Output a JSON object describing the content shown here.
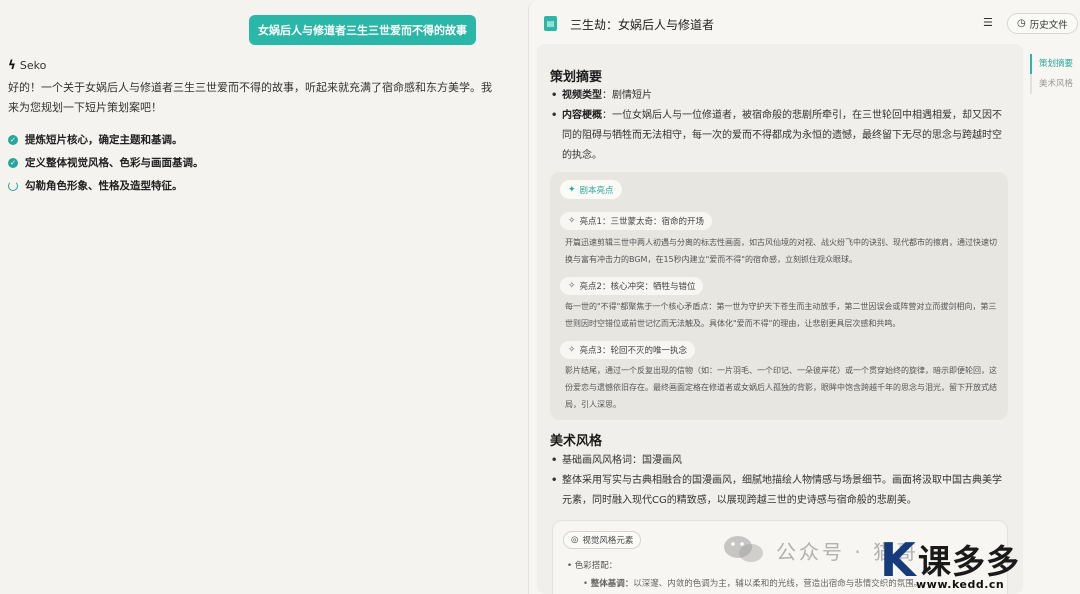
{
  "chat": {
    "user_message": "女娲后人与修道者三生三世爱而不得的故事",
    "assistant_name": "Seko",
    "assistant_intro": "好的！一个关于女娲后人与修道者三生三世爱而不得的故事，听起来就充满了宿命感和东方美学。我来为您规划一下短片策划案吧！",
    "steps": [
      {
        "label": "提炼短片核心，确定主题和基调。",
        "status": "done"
      },
      {
        "label": "定义整体视觉风格、色彩与画面基调。",
        "status": "done"
      },
      {
        "label": "勾勒角色形象、性格及造型特征。",
        "status": "in-progress"
      }
    ]
  },
  "doc": {
    "title": "三生劫：女娲后人与修道者",
    "history_label": "历史文件",
    "toc": [
      "策划摘要",
      "美术风格"
    ],
    "summary": {
      "title": "策划摘要",
      "type_label": "视频类型",
      "type_value": "剧情短片",
      "overview_label": "内容梗概",
      "overview_value": "一位女娲后人与一位修道者，被宿命般的悲剧所牵引，在三世轮回中相遇相爱，却又因不同的阻碍与牺牲而无法相守，每一次的爱而不得都成为永恒的遗憾，最终留下无尽的思念与跨越时空的执念。"
    },
    "highlights": {
      "header": "剧本亮点",
      "items": [
        {
          "title": "亮点1：三世蒙太奇：宿命的开场",
          "text": "开篇迅速剪辑三世中两人初遇与分离的标志性画面，如古风仙境的对视、战火纷飞中的诀别、现代都市的擦肩，通过快速切换与富有冲击力的BGM，在15秒内建立\"爱而不得\"的宿命感，立刻抓住观众眼球。"
        },
        {
          "title": "亮点2：核心冲突：牺牲与错位",
          "text": "每一世的\"不得\"都聚焦于一个核心矛盾点：第一世为守护天下苍生而主动放手，第二世因误会或阵营对立而拔剑相向，第三世则因时空错位或前世记忆而无法触及。具体化\"爱而不得\"的理由，让悲剧更具层次感和共鸣。"
        },
        {
          "title": "亮点3：轮回不灭的唯一执念",
          "text": "影片结尾，通过一个反复出现的信物（如：一片羽毛、一个印记、一朵彼岸花）或一个贯穿始终的旋律，暗示即便轮回，这份爱恋与遗憾依旧存在。最终画面定格在修道者或女娲后人孤独的背影，眼眸中饱含跨越千年的思念与泪光，留下开放式结局，引人深思。"
        }
      ]
    },
    "art": {
      "title": "美术风格",
      "bullet1_label": "基础画风风格词：",
      "bullet1_value": "国漫画风",
      "bullet2": "整体采用写实与古典相融合的国漫画风，细腻地描绘人物情感与场景细节。画面将汲取中国古典美学元素，同时融入现代CG的精致感，以展现跨越三世的史诗感与宿命般的悲剧美。",
      "visual_header": "视觉风格元素",
      "color_label": "色彩搭配：",
      "tone_label": "整体基调：",
      "tone_value": "以深邃、内敛的色调为主，辅以柔和的光线，营造出宿命与悲情交织的氛围。"
    }
  },
  "watermark": {
    "text": "公众号 · 猫哥",
    "brand": "课多多",
    "url": "www.kedd.cn"
  },
  "colors": {
    "accent": "#2bb7a8",
    "background": "#f4f3ef",
    "card": "#e7e6e1"
  }
}
